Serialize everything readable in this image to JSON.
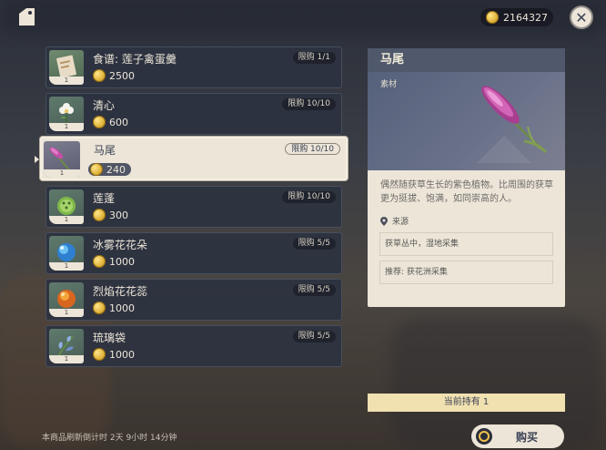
{
  "currency": {
    "amount": "2164327"
  },
  "items": [
    {
      "name": "食谱: 莲子禽蛋羹",
      "price": "2500",
      "limit": "限购 1/1",
      "qty": "1"
    },
    {
      "name": "清心",
      "price": "600",
      "limit": "限购 10/10",
      "qty": "1"
    },
    {
      "name": "马尾",
      "price": "240",
      "limit": "限购 10/10",
      "qty": "1"
    },
    {
      "name": "莲蓬",
      "price": "300",
      "limit": "限购 10/10",
      "qty": "1"
    },
    {
      "name": "冰雾花花朵",
      "price": "1000",
      "limit": "限购 5/5",
      "qty": "1"
    },
    {
      "name": "烈焰花花蕊",
      "price": "1000",
      "limit": "限购 5/5",
      "qty": "1"
    },
    {
      "name": "琉璃袋",
      "price": "1000",
      "limit": "限购 5/5",
      "qty": "1"
    }
  ],
  "detail": {
    "title": "马尾",
    "type": "素材",
    "description": "偶然随获草生长的紫色植物。比周围的获草更为挺拔、饱满，如同崇高的人。",
    "source_label": "来源",
    "sources": [
      "获草丛中，湿地采集",
      "推荐: 获花洲采集"
    ]
  },
  "holding": "当前持有 1",
  "buy_label": "购买",
  "refresh_text": "本商品刷新倒计时 2天 9小时 14分钟"
}
